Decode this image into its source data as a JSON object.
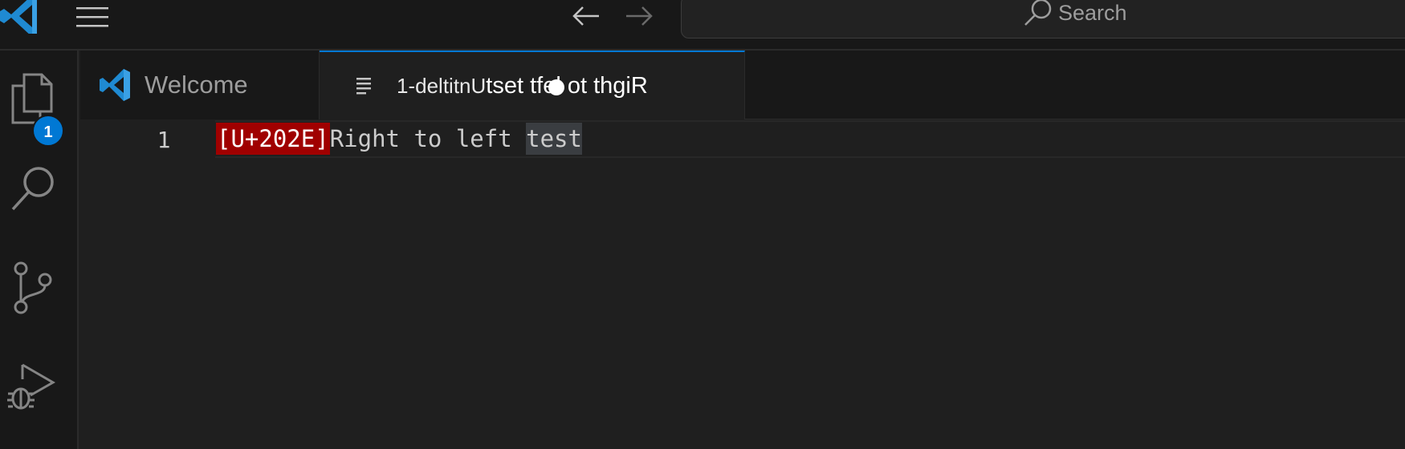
{
  "titlebar": {
    "app_icon": "vscode-logo-icon",
    "menu_icon": "hamburger-menu-icon",
    "back_icon": "arrow-left-icon",
    "forward_icon": "arrow-right-icon",
    "search": {
      "icon": "search-icon",
      "placeholder": "Search"
    }
  },
  "activity_bar": {
    "items": [
      {
        "name": "explorer",
        "icon": "files-icon",
        "badge": "1"
      },
      {
        "name": "search",
        "icon": "search-icon"
      },
      {
        "name": "source-control",
        "icon": "source-control-icon"
      },
      {
        "name": "run-and-debug",
        "icon": "run-debug-icon"
      }
    ]
  },
  "tabs": [
    {
      "label": "Welcome",
      "icon": "vscode-logo-icon",
      "active": false
    },
    {
      "label_prefix": "1-deltitnU",
      "label_main": "tset tfel ot thgiR",
      "icon": "text-file-icon",
      "active": true,
      "dirty": true
    }
  ],
  "editor": {
    "lines": [
      {
        "number": "1",
        "control_char": "[U+202E]",
        "text_before_selection": "Right to left ",
        "highlighted_word": "test"
      }
    ]
  },
  "colors": {
    "accent": "#0078d4",
    "control_char_bg": "#a00000",
    "editor_bg": "#1f1f1f",
    "chrome_bg": "#181818"
  }
}
